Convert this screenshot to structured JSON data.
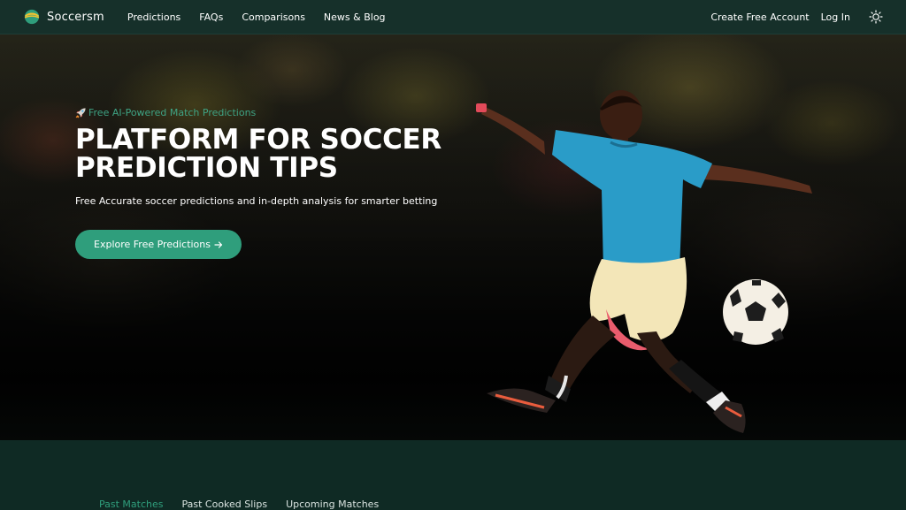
{
  "navbar": {
    "brand": "Soccersm",
    "links": [
      "Predictions",
      "FAQs",
      "Comparisons",
      "News & Blog"
    ],
    "create_account": "Create Free Account",
    "login": "Log In",
    "theme_icon": "sun-icon"
  },
  "hero": {
    "badge": "Free AI-Powered Match Predictions",
    "badge_icon": "rocket-icon",
    "title_line1": "PLATFORM FOR SOCCER",
    "title_line2": "PREDICTION TIPS",
    "subtitle": "Free Accurate soccer predictions and in-depth analysis for smarter betting",
    "cta": "Explore Free Predictions"
  },
  "tabs": {
    "items": [
      "Past Matches",
      "Past Cooked Slips",
      "Upcoming Matches"
    ],
    "active": "Past Matches"
  },
  "colors": {
    "accent": "#2f9e7c",
    "navbar_bg": "#16302a",
    "section_bg": "#0f2a24"
  }
}
